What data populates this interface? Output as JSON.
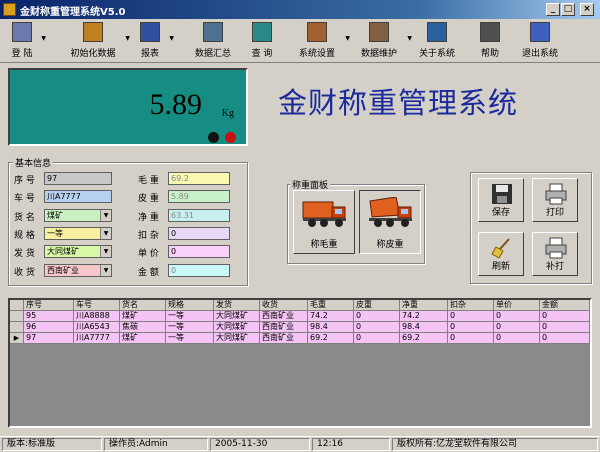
{
  "window": {
    "title": "金财称重管理系统V5.0",
    "minimize": "_",
    "maximize": "□",
    "close": "×"
  },
  "toolbar": {
    "items": [
      {
        "label": "登 陆",
        "icon": "login-icon",
        "color": "#6a7ab0"
      },
      {
        "label": "初始化数据",
        "icon": "init-data-icon",
        "color": "#c08020"
      },
      {
        "label": "报表",
        "icon": "report-icon",
        "color": "#3050a0"
      },
      {
        "label": "数据汇总",
        "icon": "summary-icon",
        "color": "#507090"
      },
      {
        "label": "查 询",
        "icon": "query-icon",
        "color": "#2a8a8a"
      },
      {
        "label": "系统设置",
        "icon": "settings-icon",
        "color": "#a06030"
      },
      {
        "label": "数据维护",
        "icon": "maintain-icon",
        "color": "#806040"
      },
      {
        "label": "关于系统",
        "icon": "about-icon",
        "color": "#2a60a0"
      },
      {
        "label": "帮助",
        "icon": "help-icon",
        "color": "#505050"
      },
      {
        "label": "退出系统",
        "icon": "exit-icon",
        "color": "#4060c0"
      }
    ],
    "dropdown": "▼"
  },
  "display": {
    "weight": "5.89",
    "unit": "Kg",
    "led1": "#111111",
    "led2": "#c81010"
  },
  "app_title": "金财称重管理系统",
  "basic_info": {
    "title": "基本信息",
    "left": [
      {
        "label": "序 号",
        "value": "97",
        "bg": "#c8c8c8",
        "select": false
      },
      {
        "label": "车 号",
        "value": "川A7777",
        "bg": "#b8d0f0",
        "select": false
      },
      {
        "label": "货 名",
        "value": "煤矿",
        "bg": "#c8f0c0",
        "select": true
      },
      {
        "label": "规 格",
        "value": "一等",
        "bg": "#f8f0a0",
        "select": true
      },
      {
        "label": "发 货",
        "value": "大同煤矿",
        "bg": "#d8f8a8",
        "select": true
      },
      {
        "label": "收 货",
        "value": "西南矿业",
        "bg": "#f8c8c8",
        "select": true
      }
    ],
    "right": [
      {
        "label": "毛 重",
        "value": "69.2",
        "bg": "#f8f8b0"
      },
      {
        "label": "皮 重",
        "value": "5.89",
        "bg": "#c8f0c8"
      },
      {
        "label": "净 重",
        "value": "63.31",
        "bg": "#c8f0f0"
      },
      {
        "label": "扣 杂",
        "value": "0",
        "bg": "#e8d8f8"
      },
      {
        "label": "单 价",
        "value": "0",
        "bg": "#f8d0f8"
      },
      {
        "label": "金 额",
        "value": "0",
        "bg": "#c8f8f8"
      }
    ]
  },
  "weigh_panel": {
    "title": "称重面板",
    "gross_label": "称毛重",
    "tare_label": "称皮重"
  },
  "actions": {
    "save": "保存",
    "print": "打印",
    "refresh": "刷新",
    "reprint": "补打"
  },
  "table": {
    "columns": [
      "序号",
      "车号",
      "货名",
      "规格",
      "发货",
      "收货",
      "毛重",
      "皮重",
      "净重",
      "扣杂",
      "单价",
      "金额"
    ],
    "rows": [
      [
        "95",
        "川A8888",
        "煤矿",
        "一等",
        "大同煤矿",
        "西南矿业",
        "74.2",
        "0",
        "74.2",
        "0",
        "0",
        "0"
      ],
      [
        "96",
        "川A6543",
        "焦碳",
        "一等",
        "大同煤矿",
        "西南矿业",
        "98.4",
        "0",
        "98.4",
        "0",
        "0",
        "0"
      ],
      [
        "97",
        "川A7777",
        "煤矿",
        "一等",
        "大同煤矿",
        "西南矿业",
        "69.2",
        "0",
        "69.2",
        "0",
        "0",
        "0"
      ]
    ],
    "current_row_marker": "▶"
  },
  "status": {
    "version": "版本:标准版",
    "operator": "操作员:Admin",
    "date": "2005-11-30",
    "time": "12:16",
    "copyright": "版权所有:亿龙堂软件有限公司"
  }
}
